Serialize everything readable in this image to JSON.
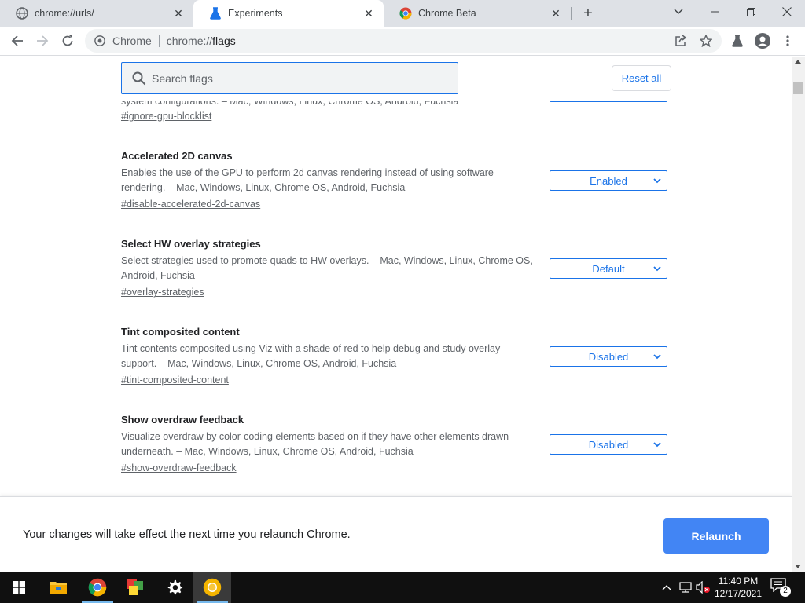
{
  "browser": {
    "tabs": [
      {
        "label": "chrome://urls/",
        "icon": "globe-icon",
        "active": false
      },
      {
        "label": "Experiments",
        "icon": "flask-icon",
        "active": true
      },
      {
        "label": "Chrome Beta",
        "icon": "chrome-icon",
        "active": false
      }
    ],
    "omnibox": {
      "site_label": "Chrome",
      "url_scheme": "chrome://",
      "url_path": "flags"
    }
  },
  "flags_page": {
    "search_placeholder": "Search flags",
    "reset_label": "Reset all",
    "partial_flag": {
      "description_tail": "system configurations. – Mac, Windows, Linux, Chrome OS, Android, Fuchsia",
      "link": "#ignore-gpu-blocklist"
    },
    "flags": [
      {
        "title": "Accelerated 2D canvas",
        "description": "Enables the use of the GPU to perform 2d canvas rendering instead of using software rendering. – Mac, Windows, Linux, Chrome OS, Android, Fuchsia",
        "link": "#disable-accelerated-2d-canvas",
        "value": "Enabled"
      },
      {
        "title": "Select HW overlay strategies",
        "description": "Select strategies used to promote quads to HW overlays. – Mac, Windows, Linux, Chrome OS, Android, Fuchsia",
        "link": "#overlay-strategies",
        "value": "Default"
      },
      {
        "title": "Tint composited content",
        "description": "Tint contents composited using Viz with a shade of red to help debug and study overlay support. – Mac, Windows, Linux, Chrome OS, Android, Fuchsia",
        "link": "#tint-composited-content",
        "value": "Disabled"
      },
      {
        "title": "Show overdraw feedback",
        "description": "Visualize overdraw by color-coding elements based on if they have other elements drawn underneath. – Mac, Windows, Linux, Chrome OS, Android, Fuchsia",
        "link": "#show-overdraw-feedback",
        "value": "Disabled"
      }
    ],
    "relaunch_message": "Your changes will take effect the next time you relaunch Chrome.",
    "relaunch_label": "Relaunch"
  },
  "taskbar": {
    "time": "11:40 PM",
    "date": "12/17/2021",
    "notification_count": "2"
  },
  "colors": {
    "accent": "#1a73e8",
    "relaunch": "#4285f4",
    "tabstrip": "#dee1e6",
    "taskbar": "#101010"
  }
}
